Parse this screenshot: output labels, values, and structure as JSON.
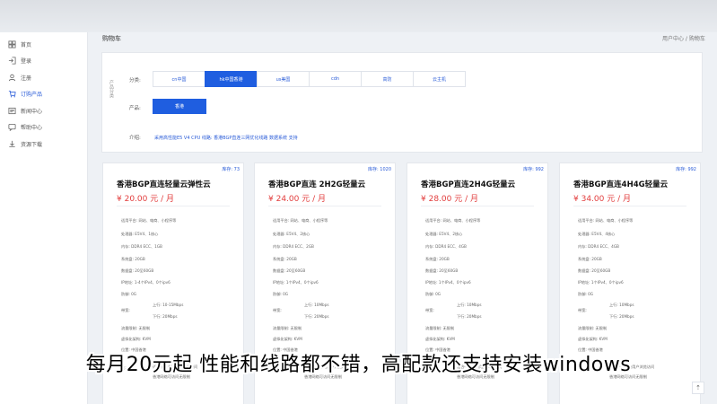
{
  "header": {
    "title": "购物车",
    "right": "用户中心 / 购物车"
  },
  "sidebar": {
    "items": [
      {
        "label": "首页",
        "icon": "dashboard-icon"
      },
      {
        "label": "登录",
        "icon": "login-icon"
      },
      {
        "label": "注册",
        "icon": "user-icon"
      },
      {
        "label": "订购产品",
        "icon": "cart-icon",
        "active": true
      },
      {
        "label": "新闻中心",
        "icon": "news-icon"
      },
      {
        "label": "帮助中心",
        "icon": "help-icon"
      },
      {
        "label": "资源下载",
        "icon": "download-icon"
      }
    ]
  },
  "filter": {
    "side_label": "产品分类",
    "category_label": "分类:",
    "categories": [
      "cn中国",
      "hk中国香港",
      "us美国",
      "cdn",
      "高防",
      "云主机"
    ],
    "active_category": 1,
    "product_label": "产品:",
    "product_button": "香港",
    "intro_label": "介绍:",
    "intro_text": "采用高性能E5 V4 CPU 线路: 香港BGP直连三网优化线路 数据系统 支持"
  },
  "cards": [
    {
      "stock": "库存: 73",
      "title": "香港BGP直连轻量云弹性云",
      "price": "¥ 20.00 元 / 月",
      "platform": "适用平台: 网站、电商、小程序等",
      "cpu": "处理器: E5V4、1核心",
      "memory": "内存: DDR4 ECC、1GB",
      "system_disk": "系统盘: 20GB",
      "data_disk": "数据盘: 20至60GB",
      "ip": "IP地址: 1-4个IPv4、0个ipv6",
      "defense": "防御: 0G",
      "bw_label": "带宽:",
      "bw_up": "上行: 10-15Mbps",
      "bw_down": "下行: 20Mbps",
      "traffic": "流量限制: 无限制",
      "virt": "虚拟化架构: KVM",
      "location": "位置: 中国香港",
      "note_label": "说:",
      "note1": "适合中国内地用户浏览访问",
      "note2": "香港网络可访问无限制"
    },
    {
      "stock": "库存: 1020",
      "title": "香港BGP直连 2H2G轻量云",
      "price": "¥ 24.00 元 / 月",
      "platform": "适用平台: 网站、电商、小程序等",
      "cpu": "处理器: E5V4、2核心",
      "memory": "内存: DDR4 ECC、2GB",
      "system_disk": "系统盘: 20GB",
      "data_disk": "数据盘: 20至60GB",
      "ip": "IP地址: 1个IPv4、0个ipv6",
      "defense": "防御: 0G",
      "bw_label": "带宽:",
      "bw_up": "上行: 10Mbps",
      "bw_down": "下行: 20Mbps",
      "traffic": "流量限制: 无限制",
      "virt": "虚拟化架构: KVM",
      "location": "位置: 中国香港",
      "note_label": "说:",
      "note1": "适合中国内地用户浏览访问",
      "note2": "香港网络可访问无限制"
    },
    {
      "stock": "库存: 992",
      "title": "香港BGP直连2H4G轻量云",
      "price": "¥ 28.00 元 / 月",
      "platform": "适用平台: 网站、电商、小程序等",
      "cpu": "处理器: E5V4、2核心",
      "memory": "内存: DDR4 ECC、4GB",
      "system_disk": "系统盘: 20GB",
      "data_disk": "数据盘: 20至60GB",
      "ip": "IP地址: 1个IPv4、0个ipv6",
      "defense": "防御: 0G",
      "bw_label": "带宽:",
      "bw_up": "上行: 10Mbps",
      "bw_down": "下行: 20Mbps",
      "traffic": "流量限制: 无限制",
      "virt": "虚拟化架构: KVM",
      "location": "位置: 中国香港",
      "note_label": "说:",
      "note1": "适合中国内地用户浏览访问",
      "note2": "香港网络可访问无限制"
    },
    {
      "stock": "库存: 992",
      "title": "香港BGP直连4H4G轻量云",
      "price": "¥ 34.00 元 / 月",
      "platform": "适用平台: 网站、电商、小程序等",
      "cpu": "处理器: E5V4、4核心",
      "memory": "内存: DDR4 ECC、4GB",
      "system_disk": "系统盘: 20GB",
      "data_disk": "数据盘: 20至60GB",
      "ip": "IP地址: 1个IPv4、0个ipv6",
      "defense": "防御: 0G",
      "bw_label": "带宽:",
      "bw_up": "上行: 10Mbps",
      "bw_down": "下行: 20Mbps",
      "traffic": "流量限制: 无限制",
      "virt": "虚拟化架构: KVM",
      "location": "位置: 中国香港",
      "note_label": "说:",
      "note1": "适合中国内地用户浏览访问",
      "note2": "香港网络可访问无限制"
    }
  ],
  "scroll_top": "⇡",
  "caption": "每月20元起 性能和线路都不错，高配款还支持安装windows",
  "colors": {
    "accent": "#1f5ee0",
    "price": "#e23d3d"
  }
}
